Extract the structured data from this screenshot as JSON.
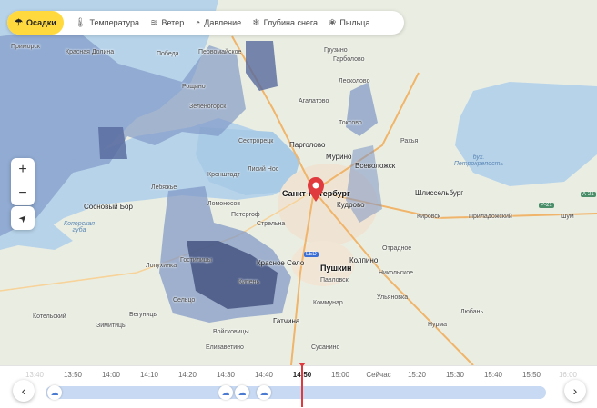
{
  "tabs": [
    {
      "label": "Осадки",
      "icon": "umbrella-cloud-icon",
      "active": true
    },
    {
      "label": "Температура",
      "icon": "thermometer-icon"
    },
    {
      "label": "Ветер",
      "icon": "wind-icon"
    },
    {
      "label": "Давление",
      "icon": "gauge-icon"
    },
    {
      "label": "Глубина снега",
      "icon": "snowflake-icon"
    },
    {
      "label": "Пыльца",
      "icon": "pollen-icon"
    }
  ],
  "controls": {
    "zoom_in": "+",
    "zoom_out": "−",
    "locate": "➤"
  },
  "map": {
    "places": {
      "primorsk": "Приморск",
      "krasnaya_dolina": "Красная Долина",
      "pobeda": "Победа",
      "pervomayskoe": "Первомайское",
      "gruzino": "Грузино",
      "garbolovo": "Гарболово",
      "roshchino": "Рощино",
      "leskolovo": "Лесколово",
      "agalatovo": "Агалатово",
      "zelenogorsk": "Зеленогорск",
      "toksovo": "Токсово",
      "sestroretsk": "Сестрорецк",
      "pargolovo": "Парголово",
      "rakhya": "Рахья",
      "lisiy_nos": "Лисий Нос",
      "murino": "Мурино",
      "kronshtadt": "Кронштадт",
      "vsevolozhsk": "Всеволожск",
      "spb": "Санкт-Петербург",
      "lebyazhye": "Лебяжье",
      "shlisselburg": "Шлиссельбург",
      "sosnovy_bor": "Сосновый Бор",
      "lomonosov": "Ломоносов",
      "kudrovo": "Кудрово",
      "petergof": "Петергоф",
      "strelna": "Стрельна",
      "kirovsk": "Кировск",
      "pridorozhnoye": "Приладожский",
      "shum": "Шум",
      "otradnoe": "Отрадное",
      "lopukhinka": "Лопухинка",
      "gostilitsy": "Гостилицы",
      "krasnoe_selo": "Красное Село",
      "pushkin": "Пушкин",
      "kolpino": "Колпино",
      "nikolskoe": "Никольское",
      "pavlovsk": "Павловск",
      "kipen": "Кипень",
      "ulyanovka": "Ульяновка",
      "selco": "Сельцо",
      "kommunar": "Коммунар",
      "kotelsky": "Котельский",
      "begunitsy": "Бегуницы",
      "gatchina": "Гатчина",
      "voyskovitsy": "Войсковицы",
      "zimitsy": "Зимитицы",
      "nurma": "Нурма",
      "lyuban": "Любань",
      "elizavetino": "Елизаветино",
      "susanino": "Сусанино",
      "led": "LED"
    },
    "water": {
      "koporskaya": "Копорская губа",
      "petrokrepost": "бух. Петрокрепость"
    },
    "roads": {
      "a21": "А-21",
      "r21": "Р-21"
    }
  },
  "timeline": {
    "ticks": [
      "13:40",
      "13:50",
      "14:00",
      "14:10",
      "14:20",
      "14:30",
      "14:40",
      "14:50",
      "15:00",
      "Сейчас",
      "15:20",
      "15:30",
      "15:40",
      "15:50",
      "16:00"
    ],
    "current": "14:50",
    "prev_label": "‹",
    "next_label": "›"
  },
  "colors": {
    "accent": "#ffd93d",
    "cursor": "#e0393e",
    "precip_light": "#7d95c4",
    "precip_heavy": "#3e4f7d"
  }
}
